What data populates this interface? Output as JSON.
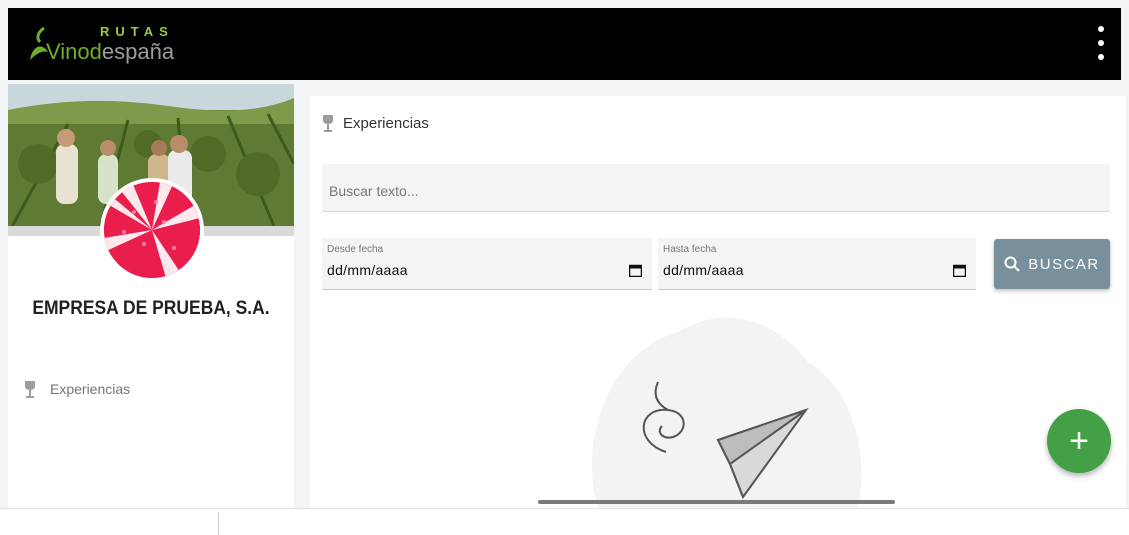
{
  "header": {
    "logo": {
      "rutas": "RUTAS",
      "vino": "Vino",
      "dot": "d",
      "espana": "españa"
    },
    "menu_icon": "more-vert-icon"
  },
  "sidebar": {
    "company_name": "EMPRESA DE PRUEBA, S.A.",
    "items": [
      {
        "label": "Experiencias",
        "icon": "wine-glass-icon"
      }
    ]
  },
  "main": {
    "title": "Experiencias",
    "title_icon": "wine-glass-icon",
    "search": {
      "placeholder": "Buscar texto...",
      "value": ""
    },
    "date_from": {
      "label": "Desde fecha",
      "value": "dd/mm/aaaa"
    },
    "date_to": {
      "label": "Hasta fecha",
      "value": "dd/mm/aaaa"
    },
    "search_button": {
      "label": "BUSCAR",
      "icon": "search-icon"
    }
  },
  "fab": {
    "label": "+"
  },
  "colors": {
    "accent": "#43a047",
    "button": "#78909c",
    "topbar": "#000000",
    "brand_green": "#6fae2b"
  }
}
